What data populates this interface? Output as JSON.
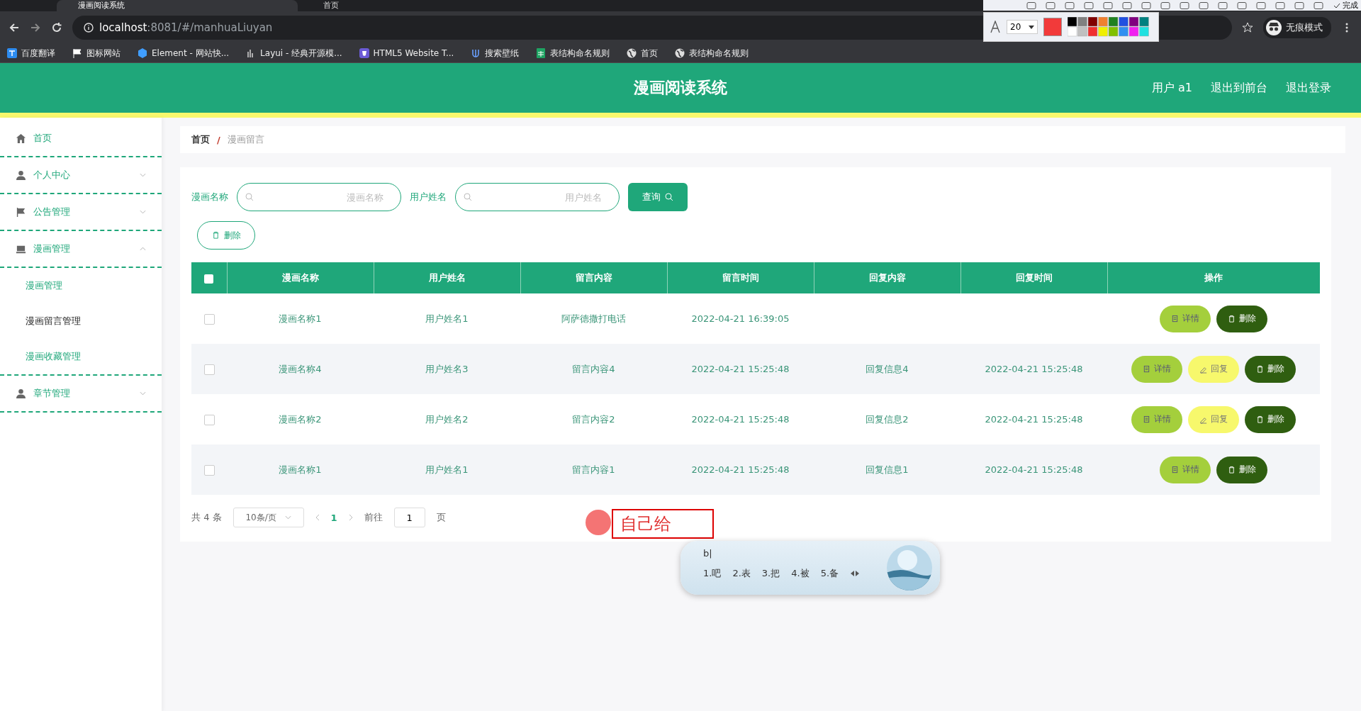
{
  "browser": {
    "tabs": [
      {
        "title": "漫画阅读系统",
        "selected": true
      },
      {
        "title": "首页",
        "selected": false
      }
    ],
    "url": {
      "host": "localhost",
      "rest": ":8081/#/manhuaLiuyan"
    },
    "bookmarks": [
      {
        "label": "百度翻译",
        "kind": "translate"
      },
      {
        "label": "图标网站",
        "kind": "flag"
      },
      {
        "label": "Element - 网站快...",
        "kind": "cube"
      },
      {
        "label": "Layui - 经典开源模...",
        "kind": "bars"
      },
      {
        "label": "HTML5 Website T...",
        "kind": "shield"
      },
      {
        "label": "搜索壁纸",
        "kind": "fork"
      },
      {
        "label": "表结构命名规则",
        "kind": "sheet"
      },
      {
        "label": "首页",
        "kind": "globe"
      },
      {
        "label": "表结构命名规则",
        "kind": "globe"
      }
    ],
    "incognito_label": "无痕模式"
  },
  "capture_toolbar": {
    "font_size": "20",
    "done": "完成"
  },
  "header": {
    "title": "漫画阅读系统",
    "links": [
      "用户 a1",
      "退出到前台",
      "退出登录"
    ]
  },
  "sidebar": {
    "items": [
      {
        "label": "首页",
        "kind": "home"
      },
      {
        "label": "个人中心",
        "kind": "user",
        "expanded": false
      },
      {
        "label": "公告管理",
        "kind": "flag",
        "expanded": false
      },
      {
        "label": "漫画管理",
        "kind": "book",
        "expanded": true,
        "children": [
          {
            "label": "漫画管理",
            "selected": false
          },
          {
            "label": "漫画留言管理",
            "selected": true
          },
          {
            "label": "漫画收藏管理",
            "selected": false
          }
        ]
      },
      {
        "label": "章节管理",
        "kind": "user",
        "expanded": false
      }
    ]
  },
  "breadcrumb": {
    "items": [
      "首页",
      "漫画留言"
    ],
    "separator": "/"
  },
  "search": {
    "fields": [
      {
        "label": "漫画名称",
        "placeholder": "漫画名称"
      },
      {
        "label": "用户姓名",
        "placeholder": "用户姓名"
      }
    ],
    "button": "查询"
  },
  "delete_button": "删除",
  "table": {
    "all_checked": false,
    "columns": [
      "漫画名称",
      "用户姓名",
      "留言内容",
      "留言时间",
      "回复内容",
      "回复时间",
      "操作"
    ],
    "rows": [
      {
        "checked": false,
        "cells": [
          "漫画名称1",
          "用户姓名1",
          "阿萨德撒打电话",
          "2022-04-21 16:39:05",
          "",
          ""
        ],
        "actions": [
          {
            "kind": "detail",
            "label": "详情"
          },
          {
            "kind": "delete",
            "label": "删除"
          }
        ]
      },
      {
        "checked": false,
        "cells": [
          "漫画名称4",
          "用户姓名3",
          "留言内容4",
          "2022-04-21 15:25:48",
          "回复信息4",
          "2022-04-21 15:25:48"
        ],
        "actions": [
          {
            "kind": "detail",
            "label": "详情"
          },
          {
            "kind": "reply",
            "label": "回复"
          },
          {
            "kind": "delete",
            "label": "删除"
          }
        ]
      },
      {
        "checked": false,
        "cells": [
          "漫画名称2",
          "用户姓名2",
          "留言内容2",
          "2022-04-21 15:25:48",
          "回复信息2",
          "2022-04-21 15:25:48"
        ],
        "actions": [
          {
            "kind": "detail",
            "label": "详情"
          },
          {
            "kind": "reply",
            "label": "回复"
          },
          {
            "kind": "delete",
            "label": "删除"
          }
        ]
      },
      {
        "checked": false,
        "cells": [
          "漫画名称1",
          "用户姓名1",
          "留言内容1",
          "2022-04-21 15:25:48",
          "回复信息1",
          "2022-04-21 15:25:48"
        ],
        "actions": [
          {
            "kind": "detail",
            "label": "详情"
          },
          {
            "kind": "delete",
            "label": "删除"
          }
        ]
      }
    ]
  },
  "pagination": {
    "total": "共 4 条",
    "page_size": "10条/页",
    "pages": [
      {
        "label": "1",
        "selected": true
      }
    ],
    "goto_label": "前往",
    "goto_value": "1",
    "page_unit": "页"
  },
  "annotation": {
    "text": "自己给"
  },
  "ime": {
    "input": "b|",
    "candidates": [
      "1.吧",
      "2.表",
      "3.把",
      "4.被",
      "5.备"
    ]
  }
}
